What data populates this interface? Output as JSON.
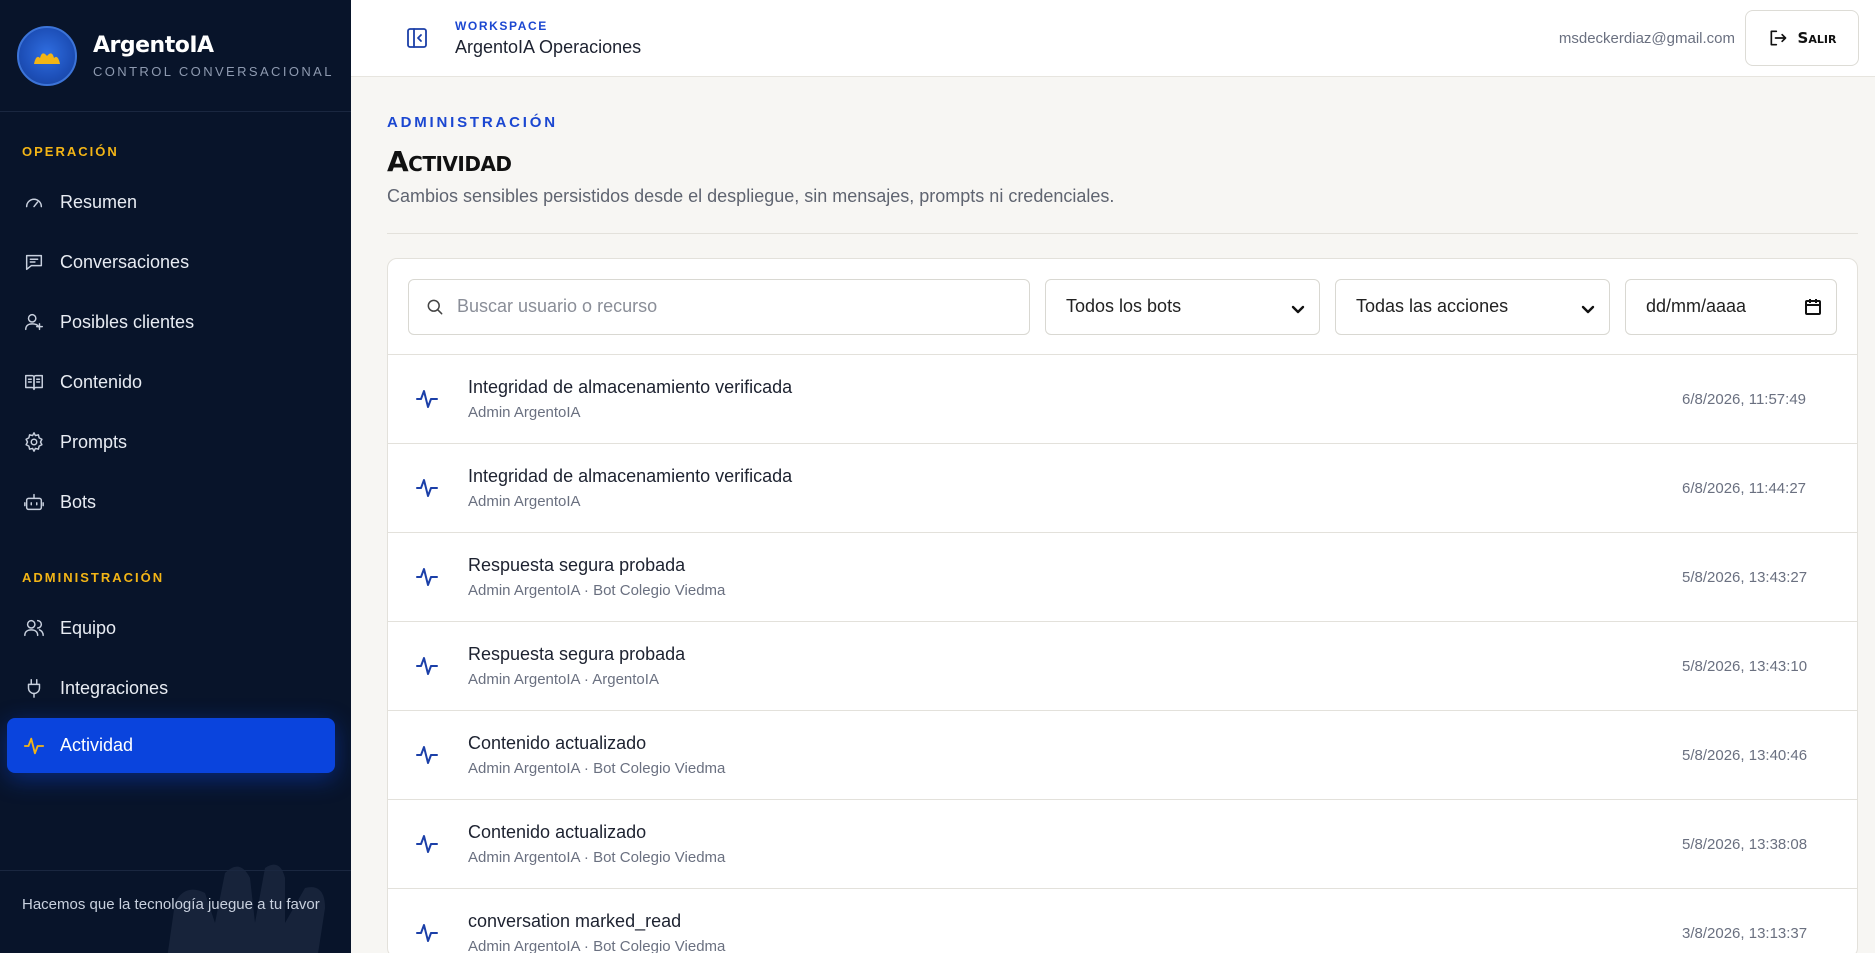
{
  "brand": {
    "name": "ArgentoIA",
    "subtitle": "CONTROL CONVERSACIONAL"
  },
  "sidebar": {
    "operation_heading": "OPERACIÓN",
    "operation_items": [
      {
        "label": "Resumen",
        "icon": "gauge-icon"
      },
      {
        "label": "Conversaciones",
        "icon": "message-icon"
      },
      {
        "label": "Posibles clientes",
        "icon": "user-icon"
      },
      {
        "label": "Contenido",
        "icon": "book-icon"
      },
      {
        "label": "Prompts",
        "icon": "gear-icon"
      },
      {
        "label": "Bots",
        "icon": "bot-icon"
      }
    ],
    "admin_heading": "ADMINISTRACIÓN",
    "admin_items": [
      {
        "label": "Equipo",
        "icon": "users-icon"
      },
      {
        "label": "Integraciones",
        "icon": "plug-icon"
      },
      {
        "label": "Actividad",
        "icon": "activity-icon",
        "active": true
      }
    ],
    "footer": "Hacemos que la tecnología juegue a tu favor"
  },
  "topbar": {
    "workspace_label": "WORKSPACE",
    "workspace_name": "ArgentoIA Operaciones",
    "user_email": "msdeckerdiaz@gmail.com",
    "logout_label": "Salir"
  },
  "page": {
    "eyebrow": "ADMINISTRACIÓN",
    "title": "Actividad",
    "subtitle": "Cambios sensibles persistidos desde el despliegue, sin mensajes, prompts ni credenciales."
  },
  "filters": {
    "search_placeholder": "Buscar usuario o recurso",
    "bots_selected": "Todos los bots",
    "actions_selected": "Todas las acciones",
    "date_placeholder": "dd/mm/aaaa"
  },
  "activity": [
    {
      "title": "Integridad de almacenamiento verificada",
      "meta": "Admin ArgentoIA",
      "time": "6/8/2026, 11:57:49"
    },
    {
      "title": "Integridad de almacenamiento verificada",
      "meta": "Admin ArgentoIA",
      "time": "6/8/2026, 11:44:27"
    },
    {
      "title": "Respuesta segura probada",
      "meta": "Admin ArgentoIA · Bot Colegio Viedma",
      "time": "5/8/2026, 13:43:27"
    },
    {
      "title": "Respuesta segura probada",
      "meta": "Admin ArgentoIA · ArgentoIA",
      "time": "5/8/2026, 13:43:10"
    },
    {
      "title": "Contenido actualizado",
      "meta": "Admin ArgentoIA · Bot Colegio Viedma",
      "time": "5/8/2026, 13:40:46"
    },
    {
      "title": "Contenido actualizado",
      "meta": "Admin ArgentoIA · Bot Colegio Viedma",
      "time": "5/8/2026, 13:38:08"
    },
    {
      "title": "conversation marked_read",
      "meta": "Admin ArgentoIA · Bot Colegio Viedma",
      "time": "3/8/2026, 13:13:37"
    }
  ],
  "colors": {
    "sidebar_bg": "#08142a",
    "accent": "#0a44dd",
    "heading_gold": "#f3b516"
  }
}
